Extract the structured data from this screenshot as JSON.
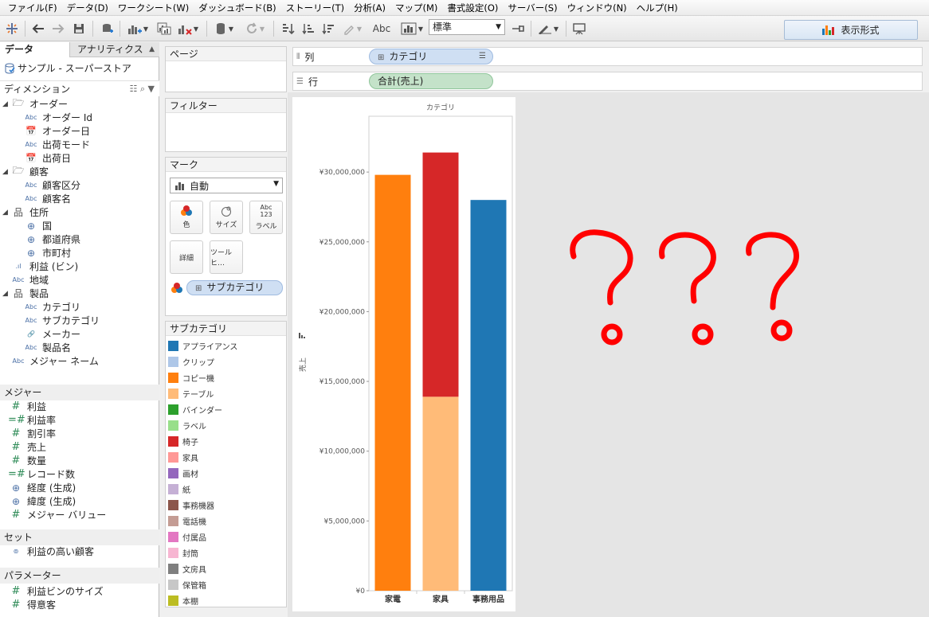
{
  "menu": [
    "ファイル(F)",
    "データ(D)",
    "ワークシート(W)",
    "ダッシュボード(B)",
    "ストーリー(T)",
    "分析(A)",
    "マップ(M)",
    "書式設定(O)",
    "サーバー(S)",
    "ウィンドウ(N)",
    "ヘルプ(H)"
  ],
  "toolbar": {
    "format_value": "標準",
    "abc_label": "Abc",
    "show_me": "表示形式"
  },
  "left_pane": {
    "tab_data": "データ",
    "tab_analytics": "アナリティクス",
    "datasource": "サンプル - スーパーストア",
    "dimensions_title": "ディメンション",
    "measures_title": "メジャー",
    "sets_title": "セット",
    "params_title": "パラメーター",
    "dimensions": [
      {
        "name": "オーダー",
        "type": "folder",
        "indent": 0,
        "tw": "◢"
      },
      {
        "name": "オーダー Id",
        "type": "abc",
        "indent": 1
      },
      {
        "name": "オーダー日",
        "type": "cal",
        "indent": 1
      },
      {
        "name": "出荷モード",
        "type": "abc",
        "indent": 1
      },
      {
        "name": "出荷日",
        "type": "cal",
        "indent": 1
      },
      {
        "name": "顧客",
        "type": "folder",
        "indent": 0,
        "tw": "◢"
      },
      {
        "name": "顧客区分",
        "type": "abc",
        "indent": 1
      },
      {
        "name": "顧客名",
        "type": "abc",
        "indent": 1
      },
      {
        "name": "住所",
        "type": "hier",
        "indent": 0,
        "tw": "◢"
      },
      {
        "name": "国",
        "type": "globe",
        "indent": 1
      },
      {
        "name": "都道府県",
        "type": "globe",
        "indent": 1
      },
      {
        "name": "市町村",
        "type": "globe",
        "indent": 1
      },
      {
        "name": "利益 (ビン)",
        "type": "bin",
        "indent": 0
      },
      {
        "name": "地域",
        "type": "abc",
        "indent": 0
      },
      {
        "name": "製品",
        "type": "hier",
        "indent": 0,
        "tw": "◢"
      },
      {
        "name": "カテゴリ",
        "type": "abc",
        "indent": 1
      },
      {
        "name": "サブカテゴリ",
        "type": "abc",
        "indent": 1
      },
      {
        "name": "メーカー",
        "type": "clip",
        "indent": 1
      },
      {
        "name": "製品名",
        "type": "abc",
        "indent": 1
      },
      {
        "name": "メジャー ネーム",
        "type": "abc",
        "indent": 0
      }
    ],
    "measures": [
      {
        "name": "利益",
        "type": "num"
      },
      {
        "name": "利益率",
        "type": "calc"
      },
      {
        "name": "割引率",
        "type": "num"
      },
      {
        "name": "売上",
        "type": "num"
      },
      {
        "name": "数量",
        "type": "num"
      },
      {
        "name": "レコード数",
        "type": "calc"
      },
      {
        "name": "経度 (生成)",
        "type": "globe"
      },
      {
        "name": "緯度 (生成)",
        "type": "globe"
      },
      {
        "name": "メジャー バリュー",
        "type": "num"
      }
    ],
    "sets": [
      {
        "name": "利益の高い顧客",
        "type": "set"
      }
    ],
    "params": [
      {
        "name": "利益ビンのサイズ",
        "type": "num"
      },
      {
        "name": "得意客",
        "type": "num"
      }
    ]
  },
  "cards": {
    "pages": "ページ",
    "filters": "フィルター",
    "marks": "マーク",
    "mark_type": "自動",
    "mark_buttons": [
      {
        "label": "色",
        "icon": "color"
      },
      {
        "label": "サイズ",
        "icon": "size"
      },
      {
        "label": "ラベル",
        "icon": "label",
        "top_text": "Abc",
        "mid_text": "123"
      },
      {
        "label": "詳細",
        "icon": "detail"
      },
      {
        "label": "ツールヒ…",
        "icon": "tooltip"
      }
    ],
    "marks_pill": "サブカテゴリ",
    "legend_title": "サブカテゴリ",
    "legend": [
      {
        "name": "アプライアンス",
        "color": "#1f77b4"
      },
      {
        "name": "クリップ",
        "color": "#aec7e8"
      },
      {
        "name": "コピー機",
        "color": "#ff7f0e"
      },
      {
        "name": "テーブル",
        "color": "#ffbb78"
      },
      {
        "name": "バインダー",
        "color": "#2ca02c"
      },
      {
        "name": "ラベル",
        "color": "#98df8a"
      },
      {
        "name": "椅子",
        "color": "#d62728"
      },
      {
        "name": "家具",
        "color": "#ff9896"
      },
      {
        "name": "画材",
        "color": "#9467bd"
      },
      {
        "name": "紙",
        "color": "#c5b0d5"
      },
      {
        "name": "事務機器",
        "color": "#8c564b"
      },
      {
        "name": "電話機",
        "color": "#c49c94"
      },
      {
        "name": "付属品",
        "color": "#e377c2"
      },
      {
        "name": "封筒",
        "color": "#f7b6d2"
      },
      {
        "name": "文房具",
        "color": "#7f7f7f"
      },
      {
        "name": "保管箱",
        "color": "#c7c7c7"
      },
      {
        "name": "本棚",
        "color": "#bcbd22"
      }
    ]
  },
  "shelves": {
    "columns_label": "列",
    "rows_label": "行",
    "columns_pill": "カテゴリ",
    "rows_pill": "合計(売上)"
  },
  "chart_data": {
    "type": "bar",
    "title": "カテゴリ",
    "ylabel": "売上",
    "ylim": [
      0,
      34000000
    ],
    "yticks": [
      0,
      5000000,
      10000000,
      15000000,
      20000000,
      25000000,
      30000000
    ],
    "ytick_labels": [
      "¥0",
      "¥5,000,000",
      "¥10,000,000",
      "¥15,000,000",
      "¥20,000,000",
      "¥25,000,000",
      "¥30,000,000"
    ],
    "categories": [
      "家電",
      "家具",
      "事務用品"
    ],
    "stacks": [
      [
        {
          "name": "コピー機",
          "value": 29800000,
          "color": "#ff7f0e"
        }
      ],
      [
        {
          "name": "テーブル",
          "value": 13900000,
          "color": "#ffbb78"
        },
        {
          "name": "椅子",
          "value": 17500000,
          "color": "#d62728"
        }
      ],
      [
        {
          "name": "アプライアンス",
          "value": 28000000,
          "color": "#1f77b4"
        }
      ]
    ]
  },
  "annotation": {
    "marks": [
      "?",
      "?",
      "?"
    ],
    "color": "#ff0000"
  }
}
